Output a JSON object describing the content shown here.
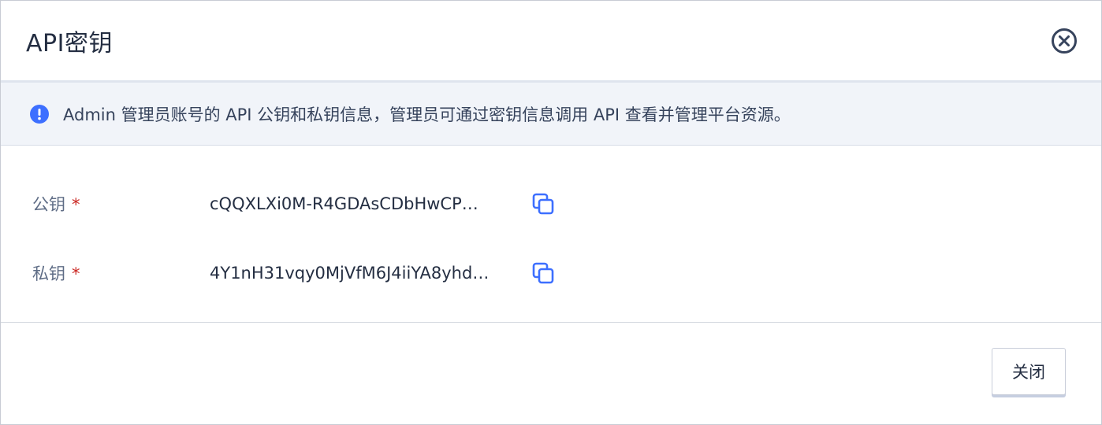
{
  "dialog": {
    "title": "API密钥",
    "close_icon": "close-circle-icon"
  },
  "alert": {
    "icon": "info-circle-icon",
    "color": "#3d6fff",
    "text": "Admin 管理员账号的 API 公钥和私钥信息，管理员可通过密钥信息调用 API 查看并管理平台资源。"
  },
  "fields": [
    {
      "label": "公钥",
      "required_mark": "*",
      "value": "cQQXLXi0M-R4GDAsCDbHwCP…",
      "copy_icon": "copy-icon"
    },
    {
      "label": "私钥",
      "required_mark": "*",
      "value": "4Y1nH31vqy0MjVfM6J4iiYA8yhd…",
      "copy_icon": "copy-icon"
    }
  ],
  "footer": {
    "close_label": "关闭"
  },
  "colors": {
    "accent": "#3d6fff",
    "required": "#ca2621",
    "alert_bg": "#f1f4f9"
  }
}
